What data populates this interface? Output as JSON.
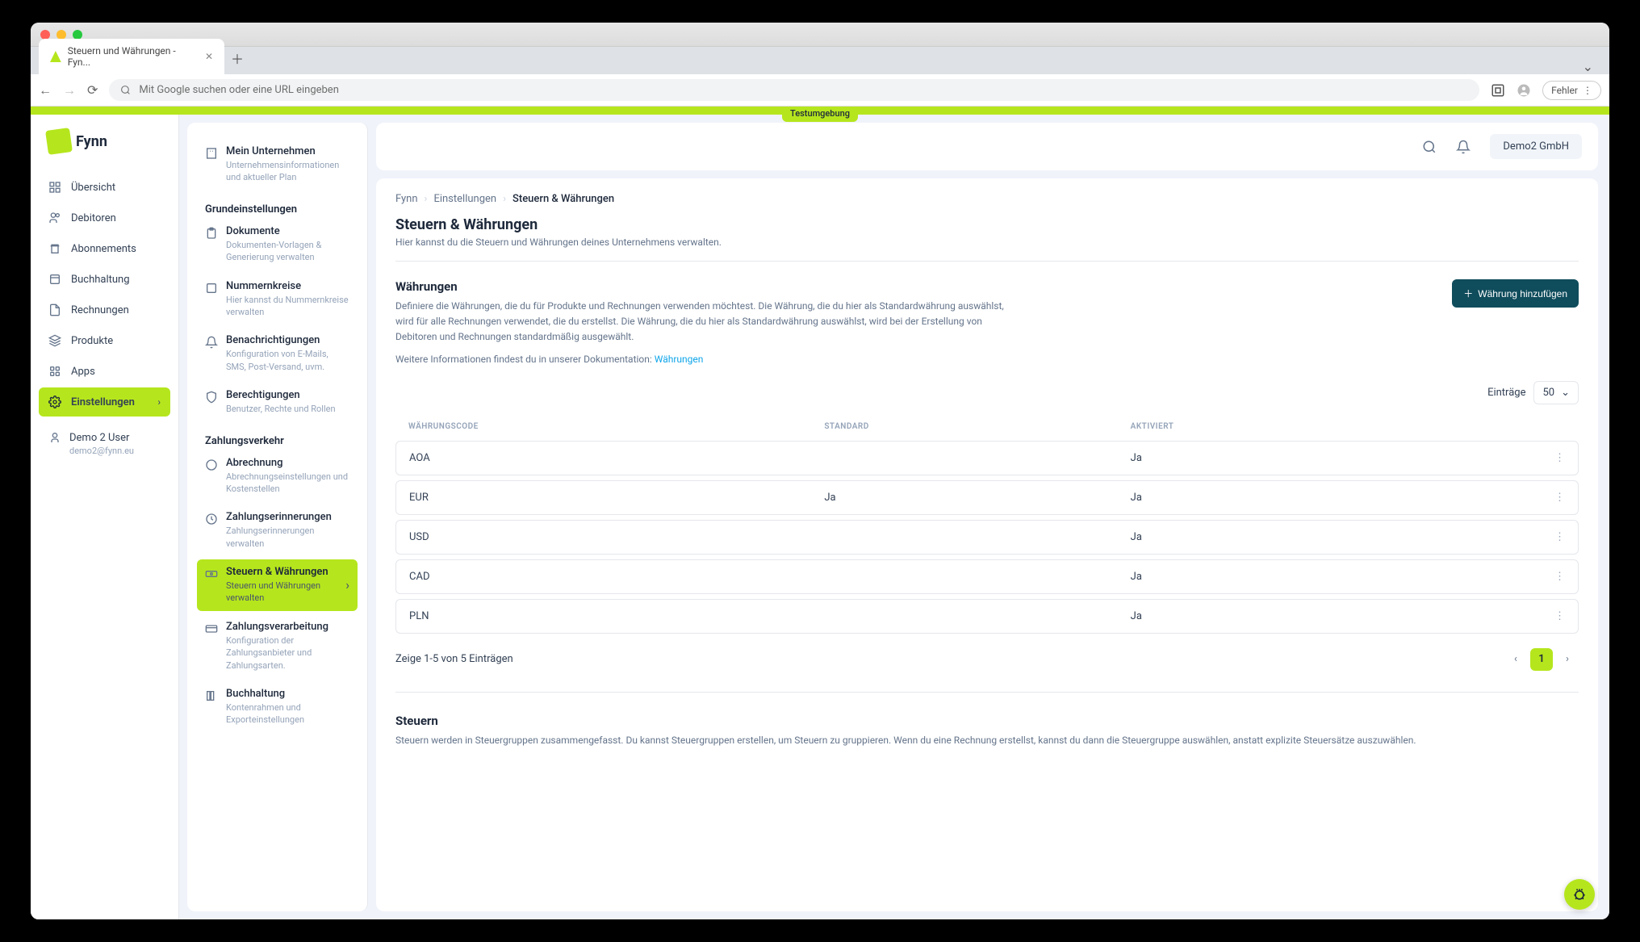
{
  "browser": {
    "tab_title": "Steuern und Währungen - Fyn...",
    "url_placeholder": "Mit Google suchen oder eine URL eingeben",
    "error_label": "Fehler"
  },
  "env_banner": "Testumgebung",
  "logo_text": "Fynn",
  "nav": {
    "items": [
      {
        "label": "Übersicht"
      },
      {
        "label": "Debitoren"
      },
      {
        "label": "Abonnements"
      },
      {
        "label": "Buchhaltung"
      },
      {
        "label": "Rechnungen"
      },
      {
        "label": "Produkte"
      },
      {
        "label": "Apps"
      },
      {
        "label": "Einstellungen"
      }
    ]
  },
  "user": {
    "name": "Demo 2 User",
    "email": "demo2@fynn.eu"
  },
  "subnav": {
    "company": {
      "title": "Mein Unternehmen",
      "desc": "Unternehmensinformationen und aktueller Plan"
    },
    "section1": "Grundeinstellungen",
    "docs": {
      "title": "Dokumente",
      "desc": "Dokumenten-Vorlagen & Generierung verwalten"
    },
    "numbers": {
      "title": "Nummernkreise",
      "desc": "Hier kannst du Nummernkreise verwalten"
    },
    "notifications": {
      "title": "Benachrichtigungen",
      "desc": "Konfiguration von E-Mails, SMS, Post-Versand, uvm."
    },
    "permissions": {
      "title": "Berechtigungen",
      "desc": "Benutzer, Rechte und Rollen"
    },
    "section2": "Zahlungsverkehr",
    "billing": {
      "title": "Abrechnung",
      "desc": "Abrechnungseinstellungen und Kostenstellen"
    },
    "reminders": {
      "title": "Zahlungserinnerungen",
      "desc": "Zahlungserinnerungen verwalten"
    },
    "taxes": {
      "title": "Steuern & Währungen",
      "desc": "Steuern und Währungen verwalten"
    },
    "processing": {
      "title": "Zahlungsverarbeitung",
      "desc": "Konfiguration der Zahlungsanbieter und Zahlungsarten."
    },
    "accounting": {
      "title": "Buchhaltung",
      "desc": "Kontenrahmen und Exporteinstellungen"
    }
  },
  "topbar": {
    "company": "Demo2 GmbH"
  },
  "breadcrumb": {
    "c1": "Fynn",
    "c2": "Einstellungen",
    "c3": "Steuern & Währungen"
  },
  "page": {
    "title": "Steuern & Währungen",
    "subtitle": "Hier kannst du die Steuern und Währungen deines Unternehmens verwalten."
  },
  "currencies": {
    "title": "Währungen",
    "desc": "Definiere die Währungen, die du für Produkte und Rechnungen verwenden möchtest. Die Währung, die du hier als Standardwährung auswählst, wird für alle Rechnungen verwendet, die du erstellst. Die Währung, die du hier als Standardwährung auswählst, wird bei der Erstellung von Debitoren und Rechnungen standardmäßig ausgewählt.",
    "doc_prefix": "Weitere Informationen findest du in unserer Dokumentation: ",
    "doc_link": "Währungen",
    "add_button": "Währung hinzufügen",
    "entries_label": "Einträge",
    "entries_value": "50",
    "columns": {
      "code": "WÄHRUNGSCODE",
      "standard": "STANDARD",
      "active": "AKTIVIERT"
    },
    "rows": [
      {
        "code": "AOA",
        "standard": "",
        "active": "Ja"
      },
      {
        "code": "EUR",
        "standard": "Ja",
        "active": "Ja"
      },
      {
        "code": "USD",
        "standard": "",
        "active": "Ja"
      },
      {
        "code": "CAD",
        "standard": "",
        "active": "Ja"
      },
      {
        "code": "PLN",
        "standard": "",
        "active": "Ja"
      }
    ],
    "footer_text": "Zeige 1-5 von 5 Einträgen",
    "page_current": "1"
  },
  "taxes_section": {
    "title": "Steuern",
    "desc": "Steuern werden in Steuergruppen zusammengefasst. Du kannst Steuergruppen erstellen, um Steuern zu gruppieren. Wenn du eine Rechnung erstellst, kannst du dann die Steuergruppe auswählen, anstatt explizite Steuersätze auszuwählen."
  }
}
